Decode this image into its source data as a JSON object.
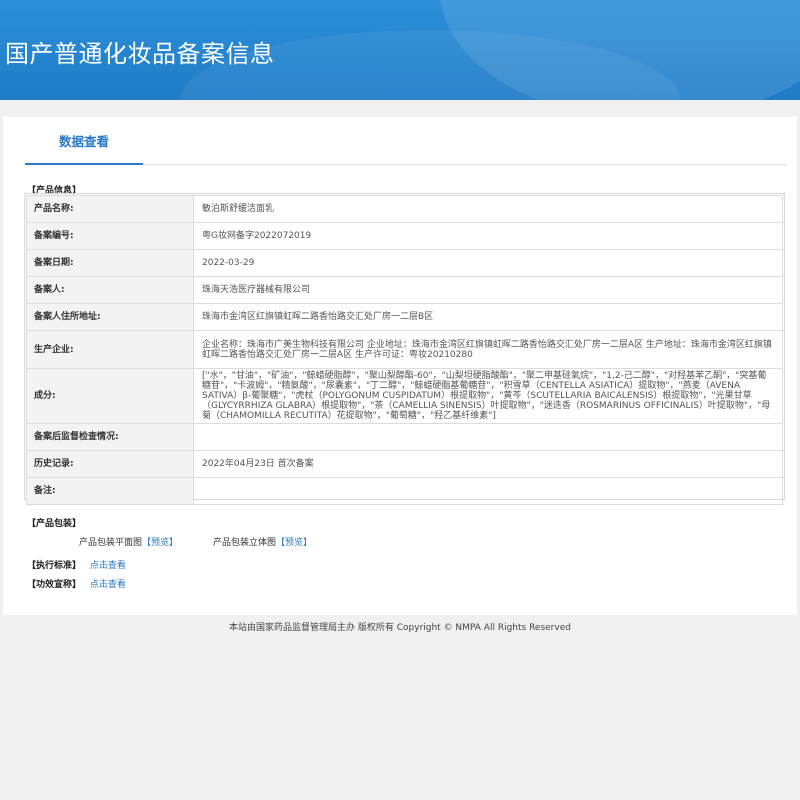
{
  "banner": {
    "title": "国产普通化妆品备案信息"
  },
  "tabs": [
    {
      "label": "数据查看"
    }
  ],
  "product_info": {
    "section_title": "【产品信息】",
    "rows": [
      {
        "label": "产品名称:",
        "value": "敏泊斯舒缓洁面乳"
      },
      {
        "label": "备案编号:",
        "value": "粤G妆网备字2022072019"
      },
      {
        "label": "备案日期:",
        "value": "2022-03-29"
      },
      {
        "label": "备案人:",
        "value": "珠海天浩医疗器械有限公司"
      },
      {
        "label": "备案人住所地址:",
        "value": "珠海市金湾区红旗镇虹晖二路香怡路交汇处厂房一二层B区"
      },
      {
        "label": "生产企业:",
        "value": "企业名称：珠海市广美生物科技有限公司 企业地址：珠海市金湾区红旗镇虹晖二路香怡路交汇处厂房一二层A区 生产地址：珠海市金湾区红旗镇虹晖二路香怡路交汇处厂房一二层A区 生产许可证：粤妆20210280"
      },
      {
        "label": "成分:",
        "value": "[\"水\"，\"甘油\"，\"矿油\"，\"鲸蜡硬脂醇\"，\"聚山梨醇酯-60\"，\"山梨坦硬脂酸酯\"，\"聚二甲基硅氧烷\"，\"1,2-己二醇\"，\"对羟基苯乙酮\"，\"突基葡糖苷\"，\"卡波姆\"，\"精氨酸\"，\"尿囊素\"，\"丁二醇\"，\"鲸蜡硬脂基葡糖苷\"，\"积雪草（CENTELLA ASIATICA）提取物\"，\"燕麦（AVENA SATIVA）β-葡聚糖\"，\"虎杖（POLYGONUM CUSPIDATUM）根提取物\"，\"黄芩（SCUTELLARIA BAICALENSIS）根提取物\"，\"光果甘草（GLYCYRRHIZA GLABRA）根提取物\"，\"茶（CAMELLIA SINENSIS）叶提取物\"，\"迷迭香（ROSMARINUS OFFICINALIS）叶提取物\"，\"母菊（CHAMOMILLA RECUTITA）花提取物\"，\"葡萄糖\"，\"羟乙基纤维素\"]"
      },
      {
        "label": "备案后监督检查情况:",
        "value": ""
      },
      {
        "label": "历史记录:",
        "value": "2022年04月23日 首次备案"
      },
      {
        "label": "备注:",
        "value": ""
      }
    ]
  },
  "packaging": {
    "section_title": "【产品包装】",
    "flat_label": "产品包装平面图",
    "flat_link": "【预览】",
    "solid_label": "产品包装立体图",
    "solid_link": "【预览】"
  },
  "standard": {
    "label": "【执行标准】",
    "link": "点击查看"
  },
  "efficacy": {
    "label": "【功效宣称】",
    "link": "点击查看"
  },
  "footer": {
    "text": "本站由国家药品监督管理局主办 版权所有 Copyright © NMPA All Rights Reserved"
  },
  "colors": {
    "banner": "#2d8fd9",
    "accent": "#2a78c7",
    "label_bg": "#f3f3f3"
  }
}
